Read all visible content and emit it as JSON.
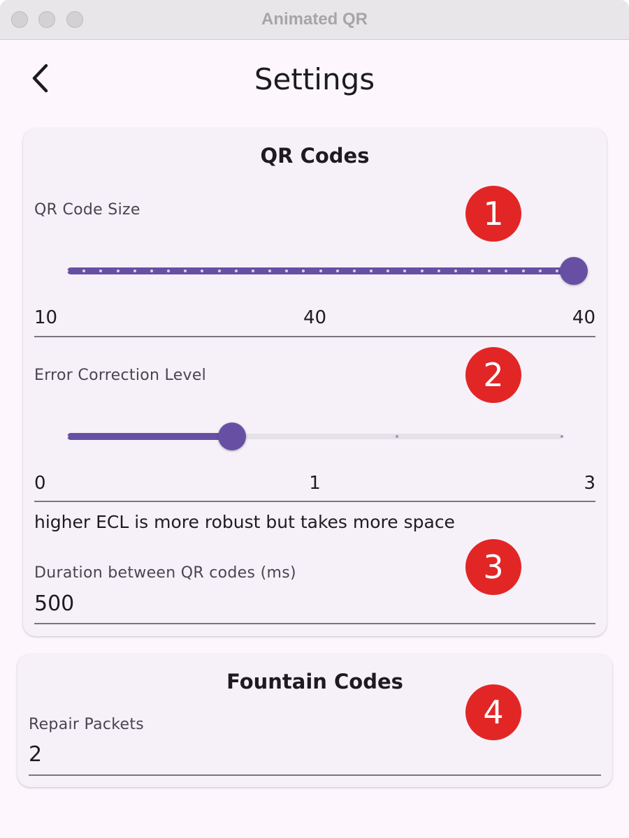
{
  "window": {
    "title": "Animated QR"
  },
  "appbar": {
    "title": "Settings",
    "back_icon": "chevron-left-icon"
  },
  "colors": {
    "accent": "#6750a4",
    "track_inactive": "#e6e0e9",
    "badge": "#e22626",
    "card_bg": "#f6f1f8",
    "page_bg": "#fdf7fd"
  },
  "qr_card": {
    "title": "QR Codes",
    "size": {
      "label": "QR Code Size",
      "min": 10,
      "max": 40,
      "value": 40,
      "divisions": 30,
      "min_label": "10",
      "value_label": "40",
      "max_label": "40"
    },
    "ecl": {
      "label": "Error Correction Level",
      "min": 0,
      "max": 3,
      "value": 1,
      "divisions": 3,
      "min_label": "0",
      "value_label": "1",
      "max_label": "3",
      "help": "higher ECL is more robust but takes more space"
    },
    "duration": {
      "label": "Duration between QR codes (ms)",
      "value": "500"
    }
  },
  "fountain_card": {
    "title": "Fountain Codes",
    "repair": {
      "label": "Repair Packets",
      "value": "2"
    }
  },
  "badges": [
    "1",
    "2",
    "3",
    "4"
  ]
}
